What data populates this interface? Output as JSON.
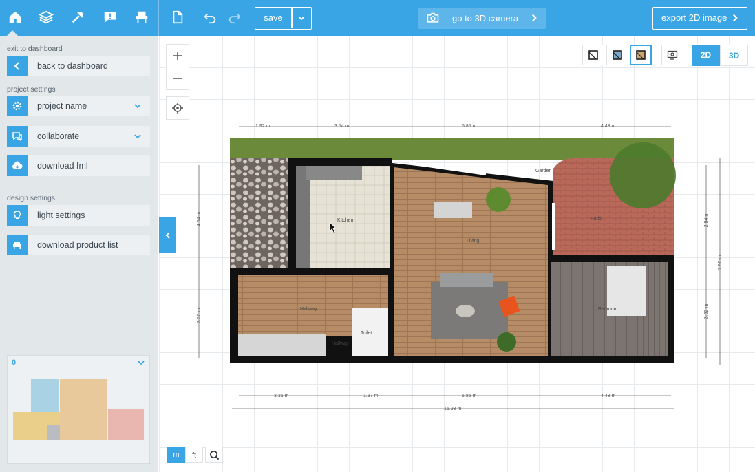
{
  "toolbar": {
    "save_label": "save",
    "camera_label": "go to 3D camera",
    "export_label": "export 2D image"
  },
  "sidebar": {
    "section_exit": "exit to dashboard",
    "back_label": "back to dashboard",
    "section_project": "project settings",
    "project_name_label": "project name",
    "collaborate_label": "collaborate",
    "download_fml_label": "download fml",
    "section_design": "design settings",
    "light_settings_label": "light settings",
    "product_list_label": "download product list",
    "minimap_level": "0"
  },
  "view_modes": {
    "mode_2d": "2D",
    "mode_3d": "3D",
    "active": "2D"
  },
  "units": {
    "metric": "m",
    "imperial": "ft",
    "active": "m"
  },
  "dimensions": {
    "top": [
      "1.92 m",
      "3.54 m",
      "5.85 m",
      "4.48 m"
    ],
    "bottom": [
      "3.36 m",
      "1.37 m",
      "5.85 m",
      "4.48 m"
    ],
    "total_bottom": "16.98 m",
    "left": [
      "4.04 m",
      "3.20 m"
    ],
    "right": [
      "2.54 m",
      "3.62 m",
      "7.90 m"
    ]
  },
  "rooms": {
    "kitchen": "Kitchen",
    "living": "Living",
    "hallway": "Hallway",
    "toilet": "Toilet",
    "hallway_small": "Hallway",
    "bedroom": "Bedroom",
    "patio": "Patio",
    "garden": "Garden"
  },
  "colors": {
    "accent": "#3aa5e5",
    "sidebar_bg": "#e2e7ea",
    "wall": "#111111",
    "grass": "#6c8c3a",
    "wood_floor": "#b08a66",
    "brick": "#b86a58"
  }
}
